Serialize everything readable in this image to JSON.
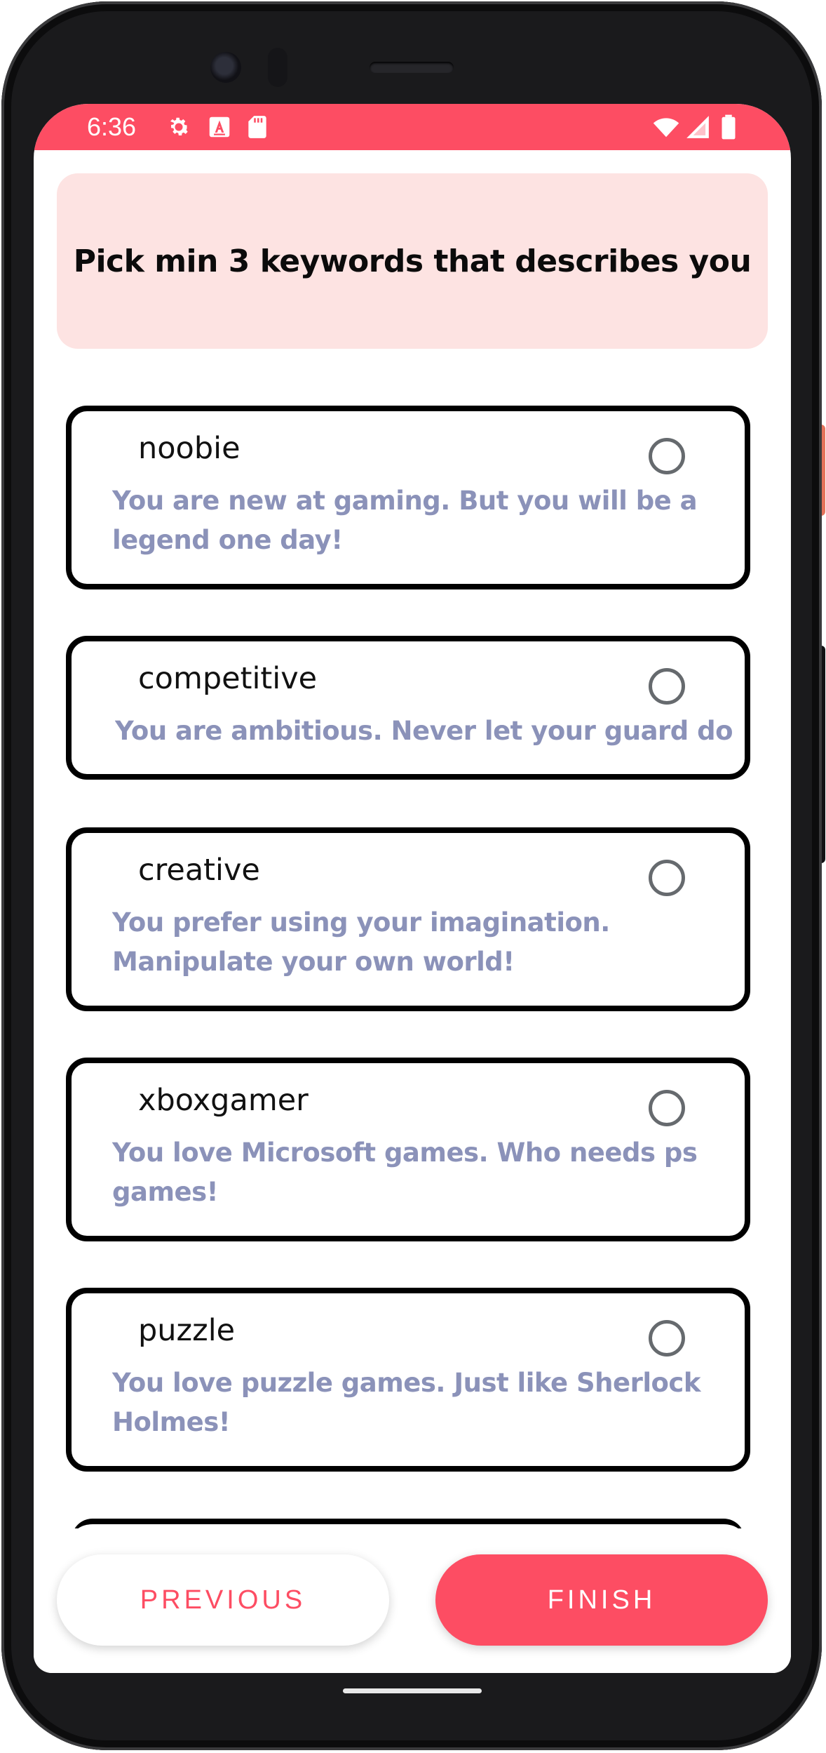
{
  "status_bar": {
    "time": "6:36",
    "left_icons": [
      "gear-icon",
      "font-a-icon",
      "sd-card-icon"
    ],
    "right_icons": [
      "wifi-icon",
      "signal-icon",
      "battery-icon"
    ],
    "background_color": "#fd4d63"
  },
  "header": {
    "title": "Pick min 3 keywords that describes you",
    "background_color": "#fde3e2"
  },
  "options": [
    {
      "name": "noobie",
      "description": "You are new at gaming. But you will be a legend one day!",
      "selected": false
    },
    {
      "name": "competitive",
      "description": "You are ambitious. Never let your guard down",
      "selected": false
    },
    {
      "name": "creative",
      "description": "You prefer using your imagination. Manipulate your own world!",
      "selected": false
    },
    {
      "name": "xboxgamer",
      "description": "You love Microsoft games. Who needs ps games!",
      "selected": false
    },
    {
      "name": "puzzle",
      "description": "You love puzzle games. Just like Sherlock Holmes!",
      "selected": false
    }
  ],
  "buttons": {
    "previous_label": "PREVIOUS",
    "finish_label": "FINISH"
  },
  "colors": {
    "accent": "#fd4d63",
    "description_text": "#8b92b9"
  }
}
